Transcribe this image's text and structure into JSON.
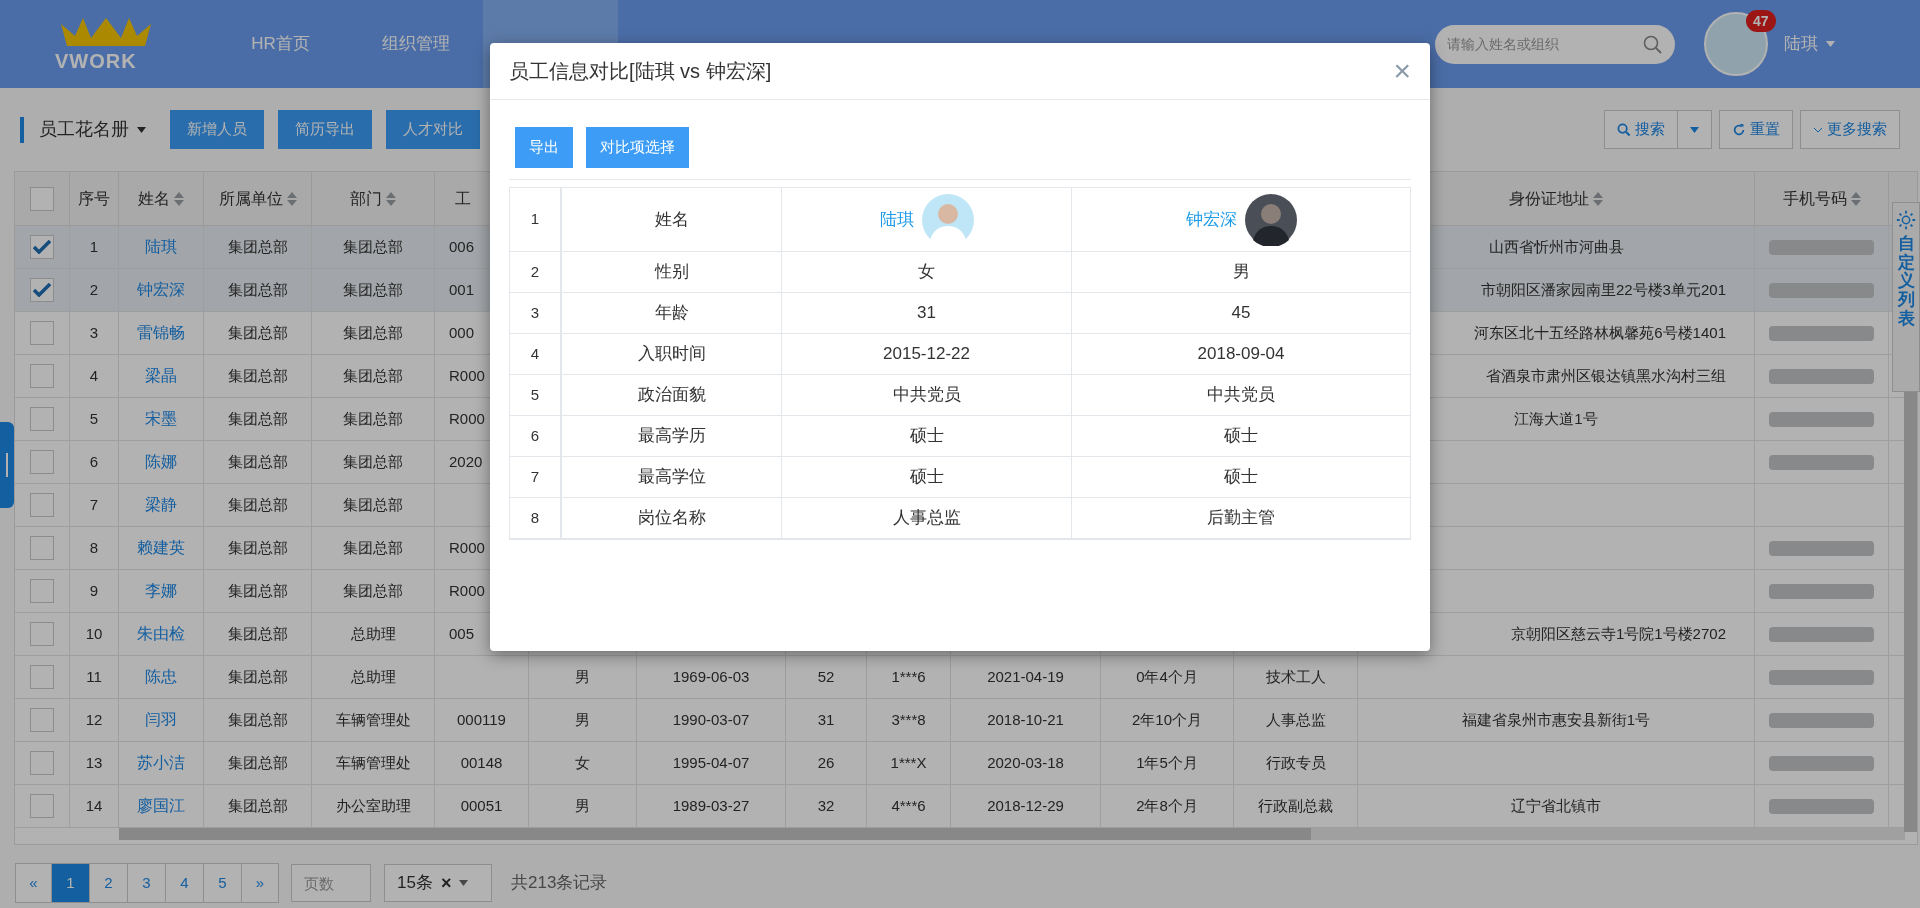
{
  "header": {
    "logo": "VWORK",
    "nav": [
      {
        "label": "HR首页",
        "selected": false
      },
      {
        "label": "组织管理",
        "selected": false
      }
    ],
    "search": {
      "placeholder": "请输入姓名或组织"
    },
    "user": {
      "badge": "47",
      "name": "陆琪"
    }
  },
  "toolbar": {
    "title": "员工花名册",
    "buttons": [
      "新增人员",
      "简历导出",
      "人才对比"
    ],
    "search_button": "搜索",
    "reset_button": "重置",
    "more_search_button": "更多搜索"
  },
  "table": {
    "header_checked": false,
    "columns": [
      {
        "label": "序号",
        "sortable": false
      },
      {
        "label": "姓名",
        "sortable": true
      },
      {
        "label": "所属单位",
        "sortable": true
      },
      {
        "label": "部门",
        "sortable": true
      },
      {
        "label": "工",
        "sortable": false
      },
      "",
      "",
      "",
      "",
      "",
      "",
      "",
      {
        "label": "身份证地址",
        "sortable": true
      },
      {
        "label": "手机号码",
        "sortable": true
      }
    ],
    "rows": [
      {
        "checked": true,
        "phone_blurred": true,
        "id_cut": true,
        "address_cut": false,
        "cells": [
          "1",
          "陆琪",
          "集团总部",
          "集团总部",
          "006",
          null,
          null,
          null,
          null,
          null,
          null,
          null,
          "山西省忻州市河曲县"
        ]
      },
      {
        "checked": true,
        "phone_blurred": true,
        "id_cut": true,
        "address_cut": true,
        "cells": [
          "2",
          "钟宏深",
          "集团总部",
          "集团总部",
          "001",
          null,
          null,
          null,
          null,
          null,
          null,
          null,
          "市朝阳区潘家园南里22号楼3单元201"
        ]
      },
      {
        "checked": false,
        "phone_blurred": true,
        "id_cut": true,
        "address_cut": true,
        "cells": [
          "3",
          "雷锦畅",
          "集团总部",
          "集团总部",
          "000",
          null,
          null,
          null,
          null,
          null,
          null,
          null,
          "河东区北十五经路林枫馨苑6号楼1401"
        ]
      },
      {
        "checked": false,
        "phone_blurred": true,
        "id_cut": true,
        "address_cut": true,
        "cells": [
          "4",
          "梁晶",
          "集团总部",
          "集团总部",
          "R000",
          null,
          null,
          null,
          null,
          null,
          null,
          null,
          "省酒泉市肃州区银达镇黑水沟村三组"
        ]
      },
      {
        "checked": false,
        "phone_blurred": true,
        "id_cut": true,
        "address_cut": false,
        "cells": [
          "5",
          "宋墨",
          "集团总部",
          "集团总部",
          "R000",
          null,
          null,
          null,
          null,
          null,
          null,
          null,
          "江海大道1号"
        ]
      },
      {
        "checked": false,
        "phone_blurred": true,
        "id_cut": true,
        "cells": [
          "6",
          "陈娜",
          "集团总部",
          "集团总部",
          "2020",
          null,
          null,
          null,
          null,
          null,
          null,
          null,
          null
        ]
      },
      {
        "checked": false,
        "phone_blurred": false,
        "cells": [
          "7",
          "梁静",
          "集团总部",
          "集团总部",
          null,
          null,
          null,
          null,
          null,
          null,
          null,
          null,
          null
        ]
      },
      {
        "checked": false,
        "phone_blurred": true,
        "id_cut": true,
        "cells": [
          "8",
          "赖建英",
          "集团总部",
          "集团总部",
          "R000",
          null,
          null,
          null,
          null,
          null,
          null,
          null,
          null
        ]
      },
      {
        "checked": false,
        "phone_blurred": true,
        "id_cut": true,
        "cells": [
          "9",
          "李娜",
          "集团总部",
          "集团总部",
          "R000",
          null,
          null,
          null,
          null,
          null,
          null,
          null,
          null
        ]
      },
      {
        "checked": false,
        "phone_blurred": true,
        "id_cut": true,
        "address_cut": true,
        "cells": [
          "10",
          "朱由检",
          "集团总部",
          "总助理",
          "005",
          null,
          null,
          null,
          null,
          null,
          null,
          null,
          "京朝阳区慈云寺1号院1号楼2702"
        ]
      },
      {
        "checked": false,
        "phone_blurred": true,
        "cells": [
          "11",
          "陈忠",
          "集团总部",
          "总助理",
          null,
          "男",
          "1969-06-03",
          "52",
          "1***6",
          "2021-04-19",
          "0年4个月",
          "技术工人",
          null
        ]
      },
      {
        "checked": false,
        "phone_blurred": true,
        "id_cut": false,
        "address_cut": false,
        "cells": [
          "12",
          "闫羽",
          "集团总部",
          "车辆管理处",
          "000119",
          "男",
          "1990-03-07",
          "31",
          "3***8",
          "2018-10-21",
          "2年10个月",
          "人事总监",
          "福建省泉州市惠安县新街1号"
        ]
      },
      {
        "checked": false,
        "phone_blurred": true,
        "id_cut": false,
        "cells": [
          "13",
          "苏小洁",
          "集团总部",
          "车辆管理处",
          "00148",
          "女",
          "1995-04-07",
          "26",
          "1***X",
          "2020-03-18",
          "1年5个月",
          "行政专员",
          null
        ]
      },
      {
        "checked": false,
        "phone_blurred": true,
        "id_cut": false,
        "address_cut": false,
        "cells": [
          "14",
          "廖国江",
          "集团总部",
          "办公室助理",
          "00051",
          "男",
          "1989-03-27",
          "32",
          "4***6",
          "2018-12-29",
          "2年8个月",
          "行政副总裁",
          "辽宁省北镇市"
        ]
      }
    ]
  },
  "side_tab": {
    "label": "自定义列表"
  },
  "pagination": {
    "prev": "«",
    "next": "»",
    "pages": [
      {
        "label": "1",
        "selected": true
      },
      {
        "label": "2",
        "selected": false
      },
      {
        "label": "3",
        "selected": false
      },
      {
        "label": "4",
        "selected": false
      },
      {
        "label": "5",
        "selected": false
      }
    ],
    "page_input_placeholder": "页数",
    "page_size": "15条",
    "clear": "×",
    "total": "共213条记录"
  },
  "modal": {
    "title": "员工信息对比[陆琪 vs 钟宏深]",
    "close": "×",
    "buttons": [
      "导出",
      "对比项选择"
    ],
    "rows": [
      {
        "index": "1",
        "label": "姓名",
        "kind": "person",
        "values": [
          "陆琪",
          "钟宏深"
        ]
      },
      {
        "index": "2",
        "label": "性别",
        "kind": "text",
        "values": [
          "女",
          "男"
        ]
      },
      {
        "index": "3",
        "label": "年龄",
        "kind": "text",
        "values": [
          "31",
          "45"
        ]
      },
      {
        "index": "4",
        "label": "入职时间",
        "kind": "text",
        "values": [
          "2015-12-22",
          "2018-09-04"
        ]
      },
      {
        "index": "5",
        "label": "政治面貌",
        "kind": "text",
        "values": [
          "中共党员",
          "中共党员"
        ]
      },
      {
        "index": "6",
        "label": "最高学历",
        "kind": "text",
        "values": [
          "硕士",
          "硕士"
        ]
      },
      {
        "index": "7",
        "label": "最高学位",
        "kind": "text",
        "values": [
          "硕士",
          "硕士"
        ]
      },
      {
        "index": "8",
        "label": "岗位名称",
        "kind": "text",
        "values": [
          "人事总监",
          "后勤主管"
        ]
      }
    ]
  }
}
